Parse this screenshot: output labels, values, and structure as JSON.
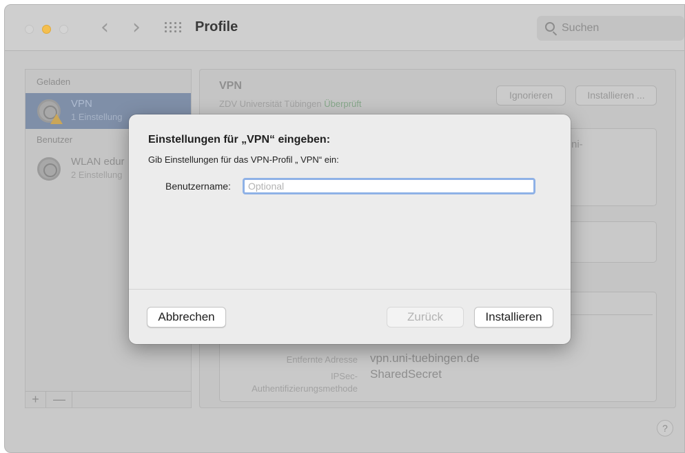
{
  "window": {
    "title": "Profile",
    "search_placeholder": "Suchen"
  },
  "sidebar": {
    "sections": [
      {
        "header": "Geladen",
        "items": [
          {
            "name": "VPN",
            "subtitle": "1 Einstellung",
            "selected": true,
            "warning": true
          }
        ]
      },
      {
        "header": "Benutzer",
        "items": [
          {
            "name": "WLAN edur",
            "subtitle": "2 Einstellung",
            "selected": false,
            "warning": false
          }
        ]
      }
    ],
    "footer": {
      "add_label": "+",
      "remove_label": "—"
    }
  },
  "detail": {
    "title": "VPN",
    "subtitle": "ZDV Universität Tübingen",
    "verified": "Überprüft",
    "ignore_label": "Ignorieren",
    "install_label": "Installieren ...",
    "truncated_text": "ni-",
    "fields": [
      {
        "label": "Entfernte Adresse",
        "value": "vpn.uni-tuebingen.de"
      },
      {
        "label": "IPSec-Authentifizierungsmethode",
        "value": "SharedSecret"
      }
    ]
  },
  "help": {
    "label": "?"
  },
  "dialog": {
    "title": "Einstellungen für „VPN“ eingeben:",
    "description": "Gib Einstellungen für das VPN-Profil „ VPN“ ein:",
    "username_label": "Benutzername:",
    "username_value": "",
    "username_placeholder": "Optional",
    "cancel_label": "Abbrechen",
    "back_label": "Zurück",
    "install_label": "Installieren"
  },
  "colors": {
    "accent_focus": "#8eb1e6",
    "verified_green": "#86a78a",
    "selected_row": "#7f8fa8",
    "minimize_yellow": "#f4bf4f"
  }
}
